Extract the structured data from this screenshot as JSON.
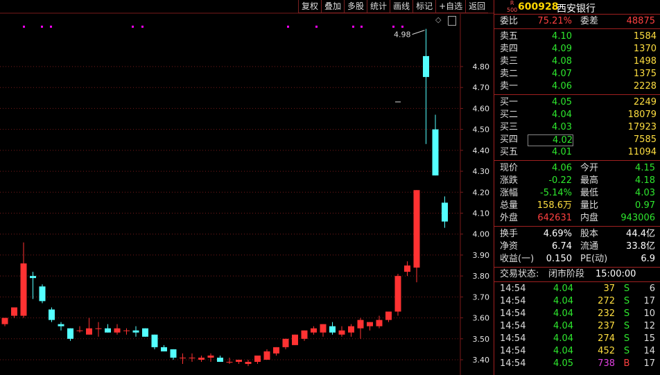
{
  "toolbar": [
    "复权",
    "叠加",
    "多股",
    "统计",
    "画线",
    "标记",
    "+自选",
    "返回"
  ],
  "chart_controls": {
    "diamond_glyph": "◇",
    "toggle_glyph": "▯"
  },
  "colors": {
    "up": "#ff3232",
    "down": "#54ffff",
    "grid": "#7a1a1a",
    "axis_text": "#e8e8e8",
    "marker": "#ff00ff"
  },
  "header": {
    "badge_top": "R",
    "badge_bottom": "500",
    "code": "600928",
    "name": "西安银行"
  },
  "weibi": {
    "label1": "委比",
    "value1": "75.21%",
    "label2": "委差",
    "value2": "48875"
  },
  "sell": [
    {
      "label": "卖五",
      "price": "4.10",
      "volume": "1584"
    },
    {
      "label": "卖四",
      "price": "4.09",
      "volume": "1370"
    },
    {
      "label": "卖三",
      "price": "4.08",
      "volume": "1498"
    },
    {
      "label": "卖二",
      "price": "4.07",
      "volume": "1375"
    },
    {
      "label": "卖一",
      "price": "4.06",
      "volume": "2228"
    }
  ],
  "buy": [
    {
      "label": "买一",
      "price": "4.05",
      "volume": "2249"
    },
    {
      "label": "买二",
      "price": "4.04",
      "volume": "18079"
    },
    {
      "label": "买三",
      "price": "4.03",
      "volume": "17923"
    },
    {
      "label": "买四",
      "price": "4.02",
      "volume": "7585"
    },
    {
      "label": "买五",
      "price": "4.01",
      "volume": "11094"
    }
  ],
  "quote": [
    {
      "l1": "现价",
      "v1": "4.06",
      "c1": "green",
      "l2": "今开",
      "v2": "4.15",
      "c2": "green"
    },
    {
      "l1": "涨跌",
      "v1": "-0.22",
      "c1": "green",
      "l2": "最高",
      "v2": "4.18",
      "c2": "green"
    },
    {
      "l1": "涨幅",
      "v1": "-5.14%",
      "c1": "green",
      "l2": "最低",
      "v2": "4.03",
      "c2": "green"
    },
    {
      "l1": "总量",
      "v1": "158.6万",
      "c1": "yellow",
      "l2": "量比",
      "v2": "0.97",
      "c2": "green"
    },
    {
      "l1": "外盘",
      "v1": "642631",
      "c1": "red",
      "l2": "内盘",
      "v2": "943006",
      "c2": "green"
    }
  ],
  "fundamentals": [
    {
      "l1": "换手",
      "v1": "4.69%",
      "l2": "股本",
      "v2": "44.4亿"
    },
    {
      "l1": "净资",
      "v1": "6.74",
      "l2": "流通",
      "v2": "33.8亿"
    },
    {
      "l1": "收益(一)",
      "v1": "0.150",
      "l2": "PE(动)",
      "v2": "6.9"
    }
  ],
  "status": {
    "label": "交易状态:",
    "value": "闭市阶段",
    "time": "15:00:00"
  },
  "ticks": [
    {
      "time": "14:54",
      "price": "4.04",
      "volume": "37",
      "side": "S",
      "count": "6"
    },
    {
      "time": "14:54",
      "price": "4.04",
      "volume": "272",
      "side": "S",
      "count": "17"
    },
    {
      "time": "14:54",
      "price": "4.04",
      "volume": "232",
      "side": "S",
      "count": "10"
    },
    {
      "time": "14:54",
      "price": "4.04",
      "volume": "237",
      "side": "S",
      "count": "12"
    },
    {
      "time": "14:54",
      "price": "4.04",
      "volume": "274",
      "side": "S",
      "count": "15"
    },
    {
      "time": "14:54",
      "price": "4.04",
      "volume": "452",
      "side": "S",
      "count": "14"
    },
    {
      "time": "14:54",
      "price": "4.05",
      "volume": "738",
      "side": "B",
      "count": "17"
    }
  ],
  "chart_data": {
    "type": "candlestick",
    "y_ticks": [
      "4.80",
      "4.70",
      "4.60",
      "4.50",
      "4.40",
      "4.30",
      "4.20",
      "4.10",
      "4.00",
      "3.90",
      "3.80",
      "3.70",
      "3.60",
      "3.50",
      "3.40"
    ],
    "ylim": [
      3.37,
      4.99
    ],
    "max_annotation": "4.98",
    "grid": true,
    "candles": [
      {
        "o": 3.57,
        "h": 3.6,
        "l": 3.56,
        "c": 3.6
      },
      {
        "o": 3.61,
        "h": 3.65,
        "l": 3.6,
        "c": 3.65
      },
      {
        "o": 3.61,
        "h": 3.96,
        "l": 3.6,
        "c": 3.86
      },
      {
        "o": 3.8,
        "h": 3.82,
        "l": 3.69,
        "c": 3.79
      },
      {
        "o": 3.75,
        "h": 3.76,
        "l": 3.67,
        "c": 3.68
      },
      {
        "o": 3.64,
        "h": 3.65,
        "l": 3.58,
        "c": 3.59
      },
      {
        "o": 3.57,
        "h": 3.58,
        "l": 3.54,
        "c": 3.56
      },
      {
        "o": 3.55,
        "h": 3.55,
        "l": 3.49,
        "c": 3.5
      },
      {
        "o": 3.54,
        "h": 3.56,
        "l": 3.53,
        "c": 3.54
      },
      {
        "o": 3.52,
        "h": 3.6,
        "l": 3.52,
        "c": 3.55
      },
      {
        "o": 3.55,
        "h": 3.58,
        "l": 3.51,
        "c": 3.55
      },
      {
        "o": 3.55,
        "h": 3.57,
        "l": 3.53,
        "c": 3.53
      },
      {
        "o": 3.53,
        "h": 3.57,
        "l": 3.52,
        "c": 3.55
      },
      {
        "o": 3.54,
        "h": 3.55,
        "l": 3.52,
        "c": 3.54
      },
      {
        "o": 3.54,
        "h": 3.56,
        "l": 3.51,
        "c": 3.53
      },
      {
        "o": 3.55,
        "h": 3.55,
        "l": 3.51,
        "c": 3.51
      },
      {
        "o": 3.52,
        "h": 3.52,
        "l": 3.45,
        "c": 3.46
      },
      {
        "o": 3.46,
        "h": 3.47,
        "l": 3.44,
        "c": 3.44
      },
      {
        "o": 3.45,
        "h": 3.45,
        "l": 3.4,
        "c": 3.41
      },
      {
        "o": 3.41,
        "h": 3.43,
        "l": 3.38,
        "c": 3.41
      },
      {
        "o": 3.41,
        "h": 3.43,
        "l": 3.39,
        "c": 3.41
      },
      {
        "o": 3.4,
        "h": 3.42,
        "l": 3.39,
        "c": 3.41
      },
      {
        "o": 3.41,
        "h": 3.43,
        "l": 3.39,
        "c": 3.42
      },
      {
        "o": 3.41,
        "h": 3.42,
        "l": 3.39,
        "c": 3.39
      },
      {
        "o": 3.39,
        "h": 3.41,
        "l": 3.38,
        "c": 3.39
      },
      {
        "o": 3.39,
        "h": 3.4,
        "l": 3.38,
        "c": 3.4
      },
      {
        "o": 3.38,
        "h": 3.4,
        "l": 3.37,
        "c": 3.39
      },
      {
        "o": 3.39,
        "h": 3.42,
        "l": 3.38,
        "c": 3.42
      },
      {
        "o": 3.4,
        "h": 3.45,
        "l": 3.4,
        "c": 3.44
      },
      {
        "o": 3.43,
        "h": 3.46,
        "l": 3.42,
        "c": 3.46
      },
      {
        "o": 3.46,
        "h": 3.5,
        "l": 3.45,
        "c": 3.5
      },
      {
        "o": 3.47,
        "h": 3.52,
        "l": 3.47,
        "c": 3.52
      },
      {
        "o": 3.5,
        "h": 3.54,
        "l": 3.49,
        "c": 3.54
      },
      {
        "o": 3.53,
        "h": 3.56,
        "l": 3.52,
        "c": 3.55
      },
      {
        "o": 3.53,
        "h": 3.57,
        "l": 3.51,
        "c": 3.57
      },
      {
        "o": 3.56,
        "h": 3.58,
        "l": 3.52,
        "c": 3.53
      },
      {
        "o": 3.52,
        "h": 3.56,
        "l": 3.51,
        "c": 3.54
      },
      {
        "o": 3.53,
        "h": 3.57,
        "l": 3.51,
        "c": 3.56
      },
      {
        "o": 3.55,
        "h": 3.6,
        "l": 3.5,
        "c": 3.59
      },
      {
        "o": 3.56,
        "h": 3.58,
        "l": 3.54,
        "c": 3.58
      },
      {
        "o": 3.56,
        "h": 3.61,
        "l": 3.55,
        "c": 3.59
      },
      {
        "o": 3.59,
        "h": 3.63,
        "l": 3.58,
        "c": 3.63
      },
      {
        "o": 3.63,
        "h": 3.81,
        "l": 3.61,
        "c": 3.8
      },
      {
        "o": 3.82,
        "h": 3.87,
        "l": 3.8,
        "c": 3.85
      },
      {
        "o": 3.84,
        "h": 4.21,
        "l": 3.77,
        "c": 4.21
      },
      {
        "o": 4.85,
        "h": 4.98,
        "l": 4.43,
        "c": 4.75
      },
      {
        "o": 4.5,
        "h": 4.57,
        "l": 4.28,
        "c": 4.28
      },
      {
        "o": 4.15,
        "h": 4.18,
        "l": 4.03,
        "c": 4.06
      }
    ]
  }
}
